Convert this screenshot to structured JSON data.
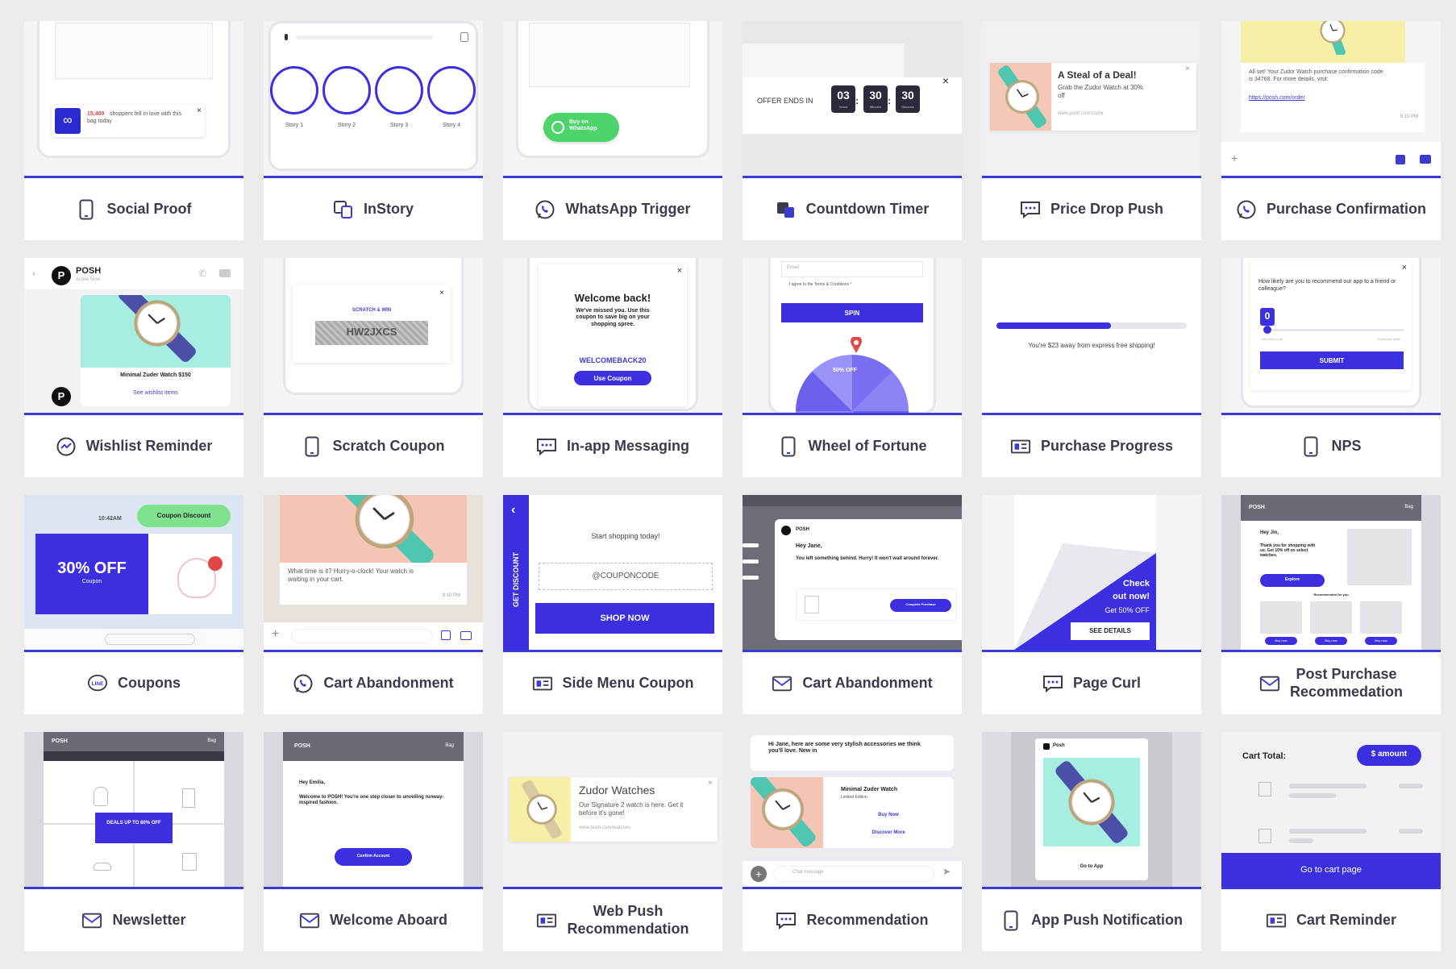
{
  "colors": {
    "accent": "#3a3ad6",
    "button": "#3b2fe0",
    "green": "#4cd46b",
    "whatsapp": "#25d366"
  },
  "cards": [
    {
      "label": "Social Proof",
      "icon": "phone-icon",
      "preview": {
        "badge": "15,400",
        "text": "shoppers fell in love with this bag today"
      }
    },
    {
      "label": "InStory",
      "icon": "stories-icon",
      "preview": {
        "stories": [
          "Story 1",
          "Story 2",
          "Story 3",
          "Story 4"
        ]
      }
    },
    {
      "label": "WhatsApp Trigger",
      "icon": "whatsapp-icon",
      "preview": {
        "button": "Buy on WhatsApp"
      }
    },
    {
      "label": "Countdown Timer",
      "icon": "countdown-icon",
      "preview": {
        "offer": "OFFER ENDS IN",
        "timer": [
          "03",
          "30",
          "30"
        ],
        "units": [
          "Hours",
          "Minutes",
          "Seconds"
        ]
      }
    },
    {
      "label": "Price Drop Push",
      "icon": "chat-icon",
      "preview": {
        "title": "A Steal of a Deal!",
        "body": "Grab the Zudor Watch at 30% off",
        "url": "www.posh.com/zudor"
      }
    },
    {
      "label": "Purchase Confirmation",
      "icon": "whatsapp-icon",
      "preview": {
        "body": "All set! Your Zudor Watch purchase confirmation code is 34768. For more details, visit:",
        "link": "https://posh.com/order",
        "time": "9:10 PM"
      }
    },
    {
      "label": "Wishlist Reminder",
      "icon": "messenger-icon",
      "preview": {
        "brand": "POSH",
        "status": "Active Now",
        "product": "Minimal Zuder Watch $150",
        "link": "See wishlist items"
      }
    },
    {
      "label": "Scratch Coupon",
      "icon": "phone-icon",
      "preview": {
        "title": "SCRATCH & WIN",
        "code": "HW2JXCS"
      }
    },
    {
      "label": "In-app Messaging",
      "icon": "chat-icon",
      "preview": {
        "title": "Welcome back!",
        "body": "We've missed you. Use this coupon to save big on your shopping spree.",
        "code": "WELCOMEBACK20",
        "button": "Use Coupon"
      }
    },
    {
      "label": "Wheel of Fortune",
      "icon": "phone-icon",
      "preview": {
        "email": "Email",
        "terms": "I agree to the Terms & Conditions *",
        "button": "SPIN",
        "slice": "50% OFF"
      }
    },
    {
      "label": "Purchase Progress",
      "icon": "banner-icon",
      "preview": {
        "text": "You're $23 away from express free shipping!",
        "progress": 0.6
      }
    },
    {
      "label": "NPS",
      "icon": "phone-icon",
      "preview": {
        "question": "How likely are you to recommend our app to a friend or colleague?",
        "score": "0",
        "low": "Not likely at all",
        "high": "Extremely likely",
        "button": "SUBMIT"
      }
    },
    {
      "label": "Coupons",
      "icon": "line-icon",
      "preview": {
        "time": "10:42AM",
        "chip": "Coupon Discount",
        "big": "30% OFF",
        "small": "Coupon"
      }
    },
    {
      "label": "Cart Abandonment",
      "icon": "whatsapp-icon",
      "preview": {
        "body": "What time is it? Hurry-o-clock! Your watch is waiting in your cart.",
        "time": "9:10 PM"
      }
    },
    {
      "label": "Side Menu Coupon",
      "icon": "banner-icon",
      "preview": {
        "side": "GET DISCOUNT",
        "title": "Start shopping today!",
        "code": "@COUPONCODE",
        "button": "SHOP NOW"
      }
    },
    {
      "label": "Cart Abandonment",
      "icon": "mail-icon",
      "preview": {
        "from": "POSH",
        "heading": "Hey Jane,",
        "body": "You left something behind. Hurry! It won't wait around forever.",
        "button": "Complete Purchase"
      }
    },
    {
      "label": "Page Curl",
      "icon": "chat-icon",
      "preview": {
        "l1": "Check",
        "l2": "out now!",
        "l3": "Get 50% OFF",
        "button": "SEE DETAILS"
      }
    },
    {
      "label": "Post Purchase\nRecommedation",
      "icon": "mail-icon",
      "preview": {
        "brand": "POSH",
        "cart": "Bag",
        "greeting": "Hey Jin,",
        "body": "Thank you for shopping with us. Get 10% off on select watches.",
        "button": "Explore",
        "rec": "Recommended for you",
        "buy": "Buy now"
      }
    },
    {
      "label": "Newsletter",
      "icon": "mail-icon",
      "preview": {
        "brand": "POSH",
        "cart": "Bag",
        "deal": "DEALS UP TO 80% OFF"
      }
    },
    {
      "label": "Welcome Aboard",
      "icon": "mail-icon",
      "preview": {
        "brand": "POSH",
        "cart": "Bag",
        "greeting": "Hey Emilia,",
        "body": "Welcome to POSH! You're one step closer to unveiling runway-inspired fashion.",
        "button": "Confirm Account"
      }
    },
    {
      "label": "Web Push\nRecommendation",
      "icon": "banner-icon",
      "preview": {
        "title": "Zudor Watches",
        "body": "Our Signature 2 watch is here. Get it before it's gone!",
        "url": "www.posh.com/watches"
      }
    },
    {
      "label": "Recommendation",
      "icon": "chat-icon",
      "preview": {
        "body": "Hi Jane, here are some very stylish accessories we think you'll love. New in",
        "product": "Minimal Zuder Watch",
        "sub": "Limited Edition",
        "buy": "Buy Now",
        "more": "Discover More",
        "chat": "Chat message"
      }
    },
    {
      "label": "App Push Notification",
      "icon": "phone-icon",
      "preview": {
        "brand": "Posh",
        "button": "Go to App"
      }
    },
    {
      "label": "Cart Reminder",
      "icon": "banner-icon",
      "preview": {
        "title": "Cart Total:",
        "amount": "$ amount",
        "button": "Go to cart page"
      }
    }
  ]
}
